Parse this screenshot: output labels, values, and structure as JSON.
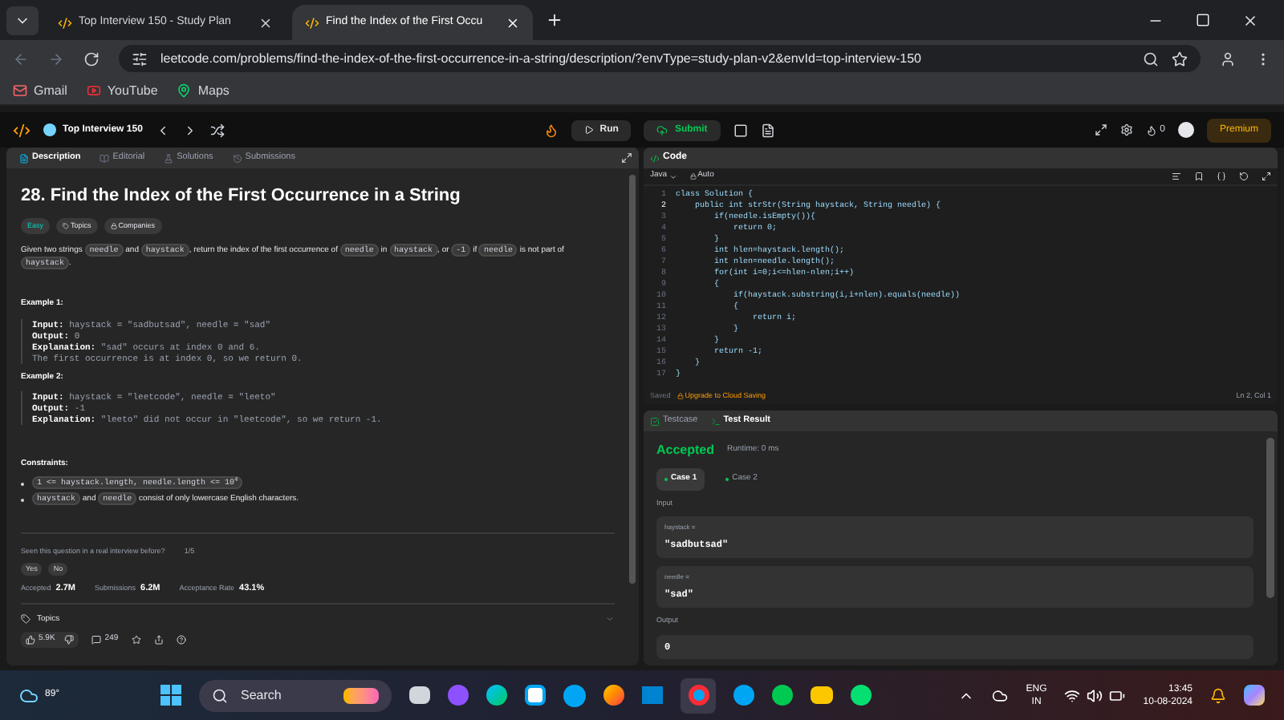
{
  "browser": {
    "tabs": [
      {
        "title": "Top Interview 150 - Study Plan",
        "selected": false
      },
      {
        "title": "Find the Index of the First Occu",
        "selected": true
      }
    ],
    "address": "leetcode.com/problems/find-the-index-of-the-first-occurrence-in-a-string/description/?envType=study-plan-v2&envId=top-interview-150",
    "bookmarks": [
      "Gmail",
      "YouTube",
      "Maps"
    ]
  },
  "navbar": {
    "list_title": "Top Interview 150",
    "run": "Run",
    "submit": "Submit",
    "streak": "0",
    "premium": "Premium"
  },
  "description_panel": {
    "tabs": [
      {
        "label": "Description",
        "selected": true
      },
      {
        "label": "Editorial",
        "selected": false
      },
      {
        "label": "Solutions",
        "selected": false
      },
      {
        "label": "Submissions",
        "selected": false
      }
    ],
    "title": "28. Find the Index of the First Occurrence in a String",
    "difficulty": "Easy",
    "tags": [
      "Topics",
      "Companies"
    ],
    "statement": [
      {
        "text": "Given two strings ",
        "code": false
      },
      {
        "text": "needle",
        "code": true
      },
      {
        "text": " and ",
        "code": false
      },
      {
        "text": "haystack",
        "code": true
      },
      {
        "text": ", return the index of the first occurrence of ",
        "code": false
      },
      {
        "text": "needle",
        "code": true
      },
      {
        "text": " in ",
        "code": false
      },
      {
        "text": "haystack",
        "code": true
      },
      {
        "text": ", or ",
        "code": false
      },
      {
        "text": "-1",
        "code": true
      },
      {
        "text": " if ",
        "code": false
      },
      {
        "text": "needle",
        "code": true
      },
      {
        "text": " is not part of ",
        "code": false
      },
      {
        "text": "haystack",
        "code": true
      },
      {
        "text": ".",
        "code": false
      }
    ],
    "examples": [
      {
        "title": "Example 1:",
        "lines": [
          {
            "label": "Input:",
            "value": " haystack = \"sadbutsad\", needle = \"sad\""
          },
          {
            "label": "Output:",
            "value": " 0"
          },
          {
            "label": "Explanation:",
            "value": " \"sad\" occurs at index 0 and 6."
          },
          {
            "value": "The first occurrence is at index 0, so we return 0."
          }
        ]
      },
      {
        "title": "Example 2:",
        "lines": [
          {
            "label": "Input:",
            "value": " haystack = \"leetcode\", needle = \"leeto\""
          },
          {
            "label": "Output:",
            "value": " -1"
          },
          {
            "label": "Explanation:",
            "value": " \"leeto\" did not occur in \"leetcode\", so we return -1."
          }
        ]
      }
    ],
    "constraints_title": "Constraints:",
    "constraints": [
      [
        {
          "text": "1 <= haystack.length, needle.length <= 10$^{4}$",
          "code": true
        }
      ],
      [
        {
          "text": "haystack",
          "code": true
        },
        {
          "text": " and ",
          "code": false
        },
        {
          "text": "needle",
          "code": true
        },
        {
          "text": " consist of only lowercase English characters.",
          "code": false
        }
      ]
    ],
    "interview_question": "Seen this question in a real interview before?",
    "interview_count": "1/5",
    "answers": [
      "Yes",
      "No"
    ],
    "stats": [
      {
        "label": "Accepted",
        "value": "2.7M"
      },
      {
        "label": "Submissions",
        "value": "6.2M"
      },
      {
        "label": "Acceptance Rate",
        "value": "43.1%"
      }
    ],
    "topics": "Topics",
    "likes": "5.9K",
    "comments": "249"
  },
  "code_panel": {
    "title": "Code",
    "language": "Java",
    "mode": "Auto",
    "lines": [
      {
        "number": "1",
        "text": "class Solution {",
        "current": false
      },
      {
        "number": "2",
        "text": "    public int strStr(String haystack, String needle) {",
        "current": true
      },
      {
        "number": "3",
        "text": "        if(needle.isEmpty()){",
        "current": false
      },
      {
        "number": "4",
        "text": "            return 0;",
        "current": false
      },
      {
        "number": "5",
        "text": "        }",
        "current": false
      },
      {
        "number": "6",
        "text": "        int hlen=haystack.length();",
        "current": false
      },
      {
        "number": "7",
        "text": "        int nlen=needle.length();",
        "current": false
      },
      {
        "number": "8",
        "text": "        for(int i=0;i<=hlen-nlen;i++)",
        "current": false
      },
      {
        "number": "9",
        "text": "        {",
        "current": false
      },
      {
        "number": "10",
        "text": "            if(haystack.substring(i,i+nlen).equals(needle))",
        "current": false
      },
      {
        "number": "11",
        "text": "            {",
        "current": false
      },
      {
        "number": "12",
        "text": "                return i;",
        "current": false
      },
      {
        "number": "13",
        "text": "            }",
        "current": false
      },
      {
        "number": "14",
        "text": "        }",
        "current": false
      },
      {
        "number": "15",
        "text": "        return -1;",
        "current": false
      },
      {
        "number": "16",
        "text": "    }",
        "current": false
      },
      {
        "number": "17",
        "text": "}",
        "current": false
      }
    ],
    "saved": "Saved",
    "upgrade": "Upgrade to Cloud Saving",
    "cursor": "Ln 2, Col 1"
  },
  "test_panel": {
    "tabs": [
      {
        "label": "Testcase",
        "selected": false
      },
      {
        "label": "Test Result",
        "selected": true
      }
    ],
    "verdict": "Accepted",
    "runtime": "Runtime: 0 ms",
    "cases": [
      {
        "label": "Case 1",
        "selected": true
      },
      {
        "label": "Case 2",
        "selected": false
      }
    ],
    "input_label": "Input",
    "inputs": [
      {
        "name": "haystack =",
        "value": "\"sadbutsad\""
      },
      {
        "name": "needle =",
        "value": "\"sad\""
      }
    ],
    "output_label": "Output",
    "output": "0"
  },
  "taskbar": {
    "weather": "89°",
    "search": "Search",
    "language": "ENG",
    "region": "IN",
    "time": "13:45",
    "date": "10-08-2024"
  }
}
